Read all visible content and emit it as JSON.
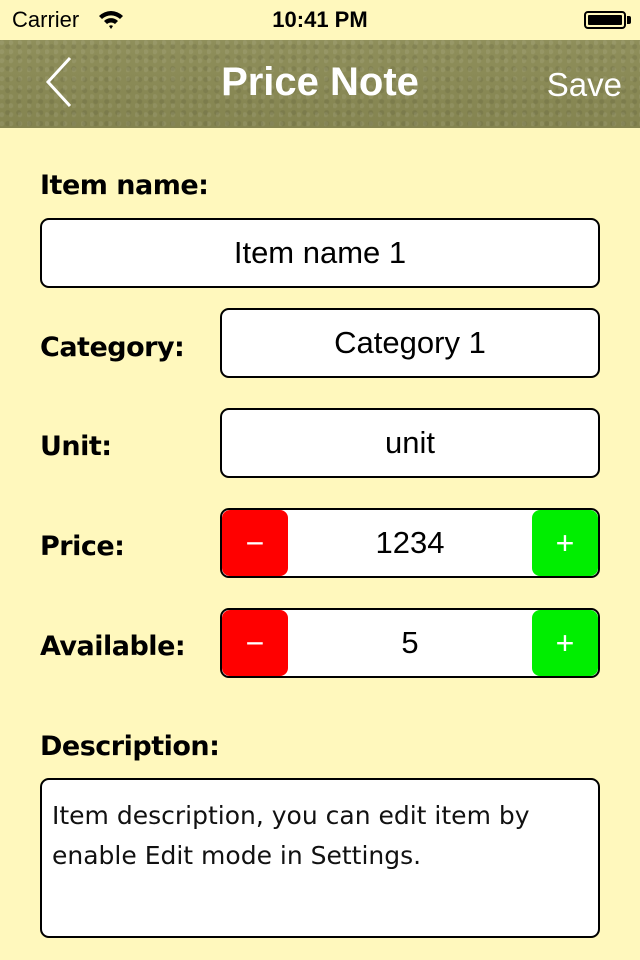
{
  "status_bar": {
    "carrier": "Carrier",
    "time": "10:41 PM",
    "wifi_icon": "wifi-icon",
    "battery_icon": "battery-full-icon"
  },
  "nav_bar": {
    "title": "Price Note",
    "back_icon": "chevron-left-icon",
    "save_label": "Save"
  },
  "form": {
    "item_name": {
      "label": "Item name:",
      "value": "Item name 1"
    },
    "category": {
      "label": "Category:",
      "value": "Category 1"
    },
    "unit": {
      "label": "Unit:",
      "value": "unit"
    },
    "price": {
      "label": "Price:",
      "value": "1234",
      "decrement": "−",
      "increment": "+"
    },
    "available": {
      "label": "Available:",
      "value": "5",
      "decrement": "−",
      "increment": "+"
    },
    "description": {
      "label": "Description:",
      "value": "Item description, you can edit item by enable Edit mode in Settings."
    }
  },
  "colors": {
    "background": "#fff8bd",
    "nav_bar": "#8a8a55",
    "decrement": "#ff0000",
    "increment": "#00ee00"
  }
}
